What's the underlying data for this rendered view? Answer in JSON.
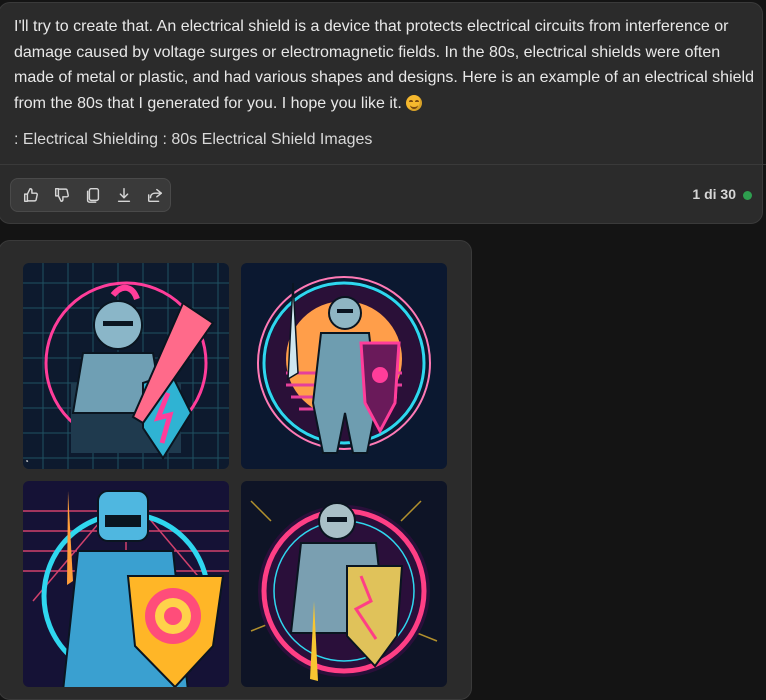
{
  "message": {
    "paragraph": "I'll try to create that. An electrical shield is a device that protects electrical circuits from interference or damage caused by voltage surges or electromagnetic fields. In the 80s, electrical shields were often made of metal or plastic, and had various shapes and designs. Here is an example of an electrical shield from the 80s that I generated for you. I hope you like it.",
    "emoji": "smiling-face-icon",
    "sources": ": Electrical Shielding : 80s Electrical Shield Images"
  },
  "actions": {
    "items": [
      "thumbs-up-icon",
      "thumbs-down-icon",
      "copy-icon",
      "download-icon",
      "share-icon"
    ]
  },
  "pagination": {
    "counter": "1 di 30",
    "status_color": "#2e9e4f"
  },
  "images": [
    {
      "name": "generated-image-1",
      "accent": "#ff3d9a",
      "secondary": "#27d3e6"
    },
    {
      "name": "generated-image-2",
      "accent": "#ffb347",
      "secondary": "#e53f9b"
    },
    {
      "name": "generated-image-3",
      "accent": "#ff4d7a",
      "secondary": "#2fd7ef"
    },
    {
      "name": "generated-image-4",
      "accent": "#ff3f85",
      "secondary": "#f7c531"
    }
  ]
}
